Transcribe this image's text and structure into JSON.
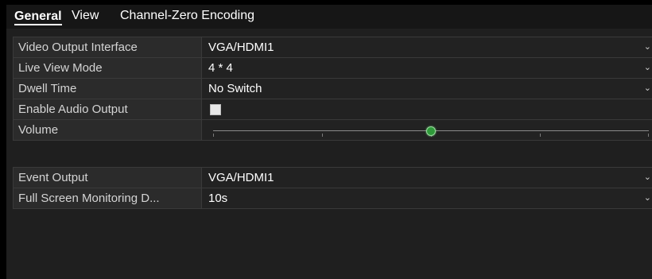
{
  "tabs": [
    {
      "label": "General",
      "active": true
    },
    {
      "label": "View",
      "active": false
    },
    {
      "label": "Channel-Zero Encoding",
      "active": false
    }
  ],
  "settings": {
    "video_output_interface": {
      "label": "Video Output Interface",
      "value": "VGA/HDMI1"
    },
    "live_view_mode": {
      "label": "Live View Mode",
      "value": "4 * 4"
    },
    "dwell_time": {
      "label": "Dwell Time",
      "value": "No Switch"
    },
    "enable_audio_output": {
      "label": "Enable Audio Output",
      "checked": false
    },
    "volume": {
      "label": "Volume",
      "level": 0.5
    },
    "event_output": {
      "label": "Event Output",
      "value": "VGA/HDMI1"
    },
    "full_screen_monitoring": {
      "label": "Full Screen Monitoring D...",
      "value": "10s"
    }
  },
  "icons": {
    "dropdown_arrow": "chevron-down-icon"
  },
  "colors": {
    "accent": "#2f9a3a",
    "background": "#1f1f1f"
  }
}
